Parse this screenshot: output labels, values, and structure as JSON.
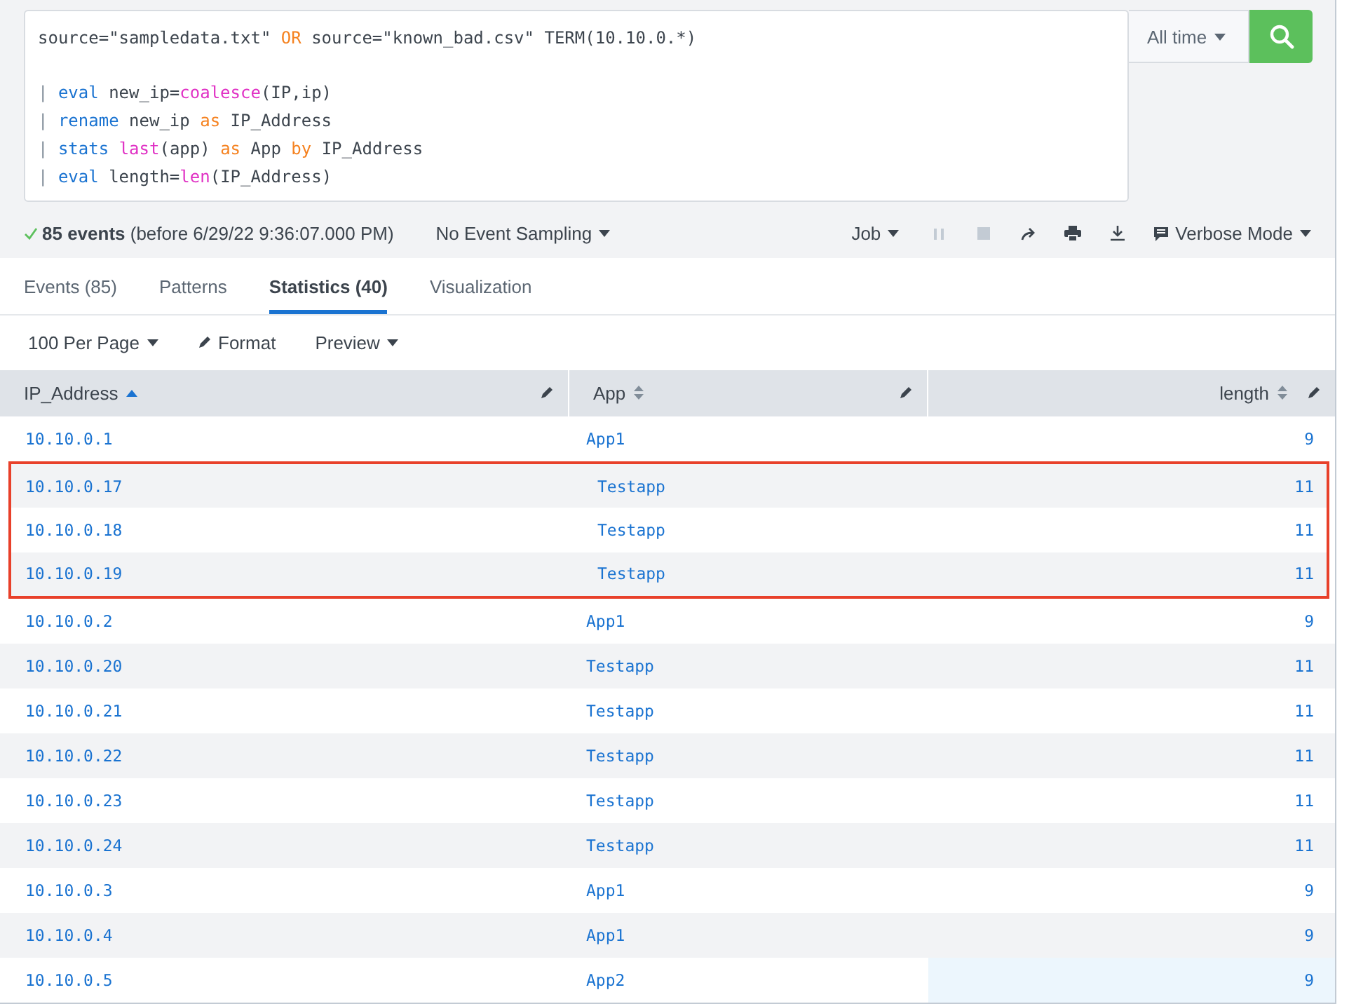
{
  "search": {
    "query_lines": [
      {
        "blank_line_before": false,
        "tokens": [
          {
            "kind": "plain",
            "text": "source=\"sampledata.txt\" "
          },
          {
            "kind": "keyword",
            "text": "OR"
          },
          {
            "kind": "plain",
            "text": " source=\"known_bad.csv\" TERM(10.10.0.*)"
          }
        ]
      },
      {
        "blank_line_before": true,
        "tokens": [
          {
            "kind": "pipe",
            "text": "| "
          },
          {
            "kind": "command",
            "text": "eval"
          },
          {
            "kind": "plain",
            "text": " new_ip="
          },
          {
            "kind": "function",
            "text": "coalesce"
          },
          {
            "kind": "plain",
            "text": "(IP,ip)"
          }
        ]
      },
      {
        "blank_line_before": false,
        "tokens": [
          {
            "kind": "pipe",
            "text": "| "
          },
          {
            "kind": "command",
            "text": "rename"
          },
          {
            "kind": "plain",
            "text": " new_ip "
          },
          {
            "kind": "keyword",
            "text": "as"
          },
          {
            "kind": "plain",
            "text": " IP_Address"
          }
        ]
      },
      {
        "blank_line_before": false,
        "tokens": [
          {
            "kind": "pipe",
            "text": "| "
          },
          {
            "kind": "command",
            "text": "stats "
          },
          {
            "kind": "function",
            "text": "last"
          },
          {
            "kind": "plain",
            "text": "(app) "
          },
          {
            "kind": "keyword",
            "text": "as"
          },
          {
            "kind": "plain",
            "text": " App "
          },
          {
            "kind": "keyword",
            "text": "by"
          },
          {
            "kind": "plain",
            "text": " IP_Address"
          }
        ]
      },
      {
        "blank_line_before": false,
        "tokens": [
          {
            "kind": "pipe",
            "text": "| "
          },
          {
            "kind": "command",
            "text": "eval"
          },
          {
            "kind": "plain",
            "text": " length="
          },
          {
            "kind": "function",
            "text": "len"
          },
          {
            "kind": "plain",
            "text": "(IP_Address)"
          }
        ]
      }
    ],
    "time_range": "All time"
  },
  "status": {
    "event_count": "85 events",
    "detail": "(before 6/29/22 9:36:07.000 PM)",
    "sampling": "No Event Sampling",
    "job": "Job",
    "mode": "Verbose Mode"
  },
  "tabs": [
    {
      "label": "Events (85)",
      "selected": false
    },
    {
      "label": "Patterns",
      "selected": false
    },
    {
      "label": "Statistics (40)",
      "selected": true
    },
    {
      "label": "Visualization",
      "selected": false
    }
  ],
  "toolbar": {
    "per_page": "100 Per Page",
    "format": "Format",
    "preview": "Preview"
  },
  "table": {
    "columns": [
      {
        "label": "IP_Address",
        "sorted_ascending": true,
        "kind": "text"
      },
      {
        "label": "App",
        "sorted_ascending": false,
        "kind": "text"
      },
      {
        "label": "length",
        "sorted_ascending": false,
        "kind": "numeric"
      }
    ],
    "rows": [
      {
        "cells": [
          "10.10.0.1",
          "App1",
          "9"
        ],
        "highlighted": false,
        "hovered": false
      },
      {
        "cells": [
          "10.10.0.17",
          "Testapp",
          "11"
        ],
        "highlighted": true,
        "hovered": false
      },
      {
        "cells": [
          "10.10.0.18",
          "Testapp",
          "11"
        ],
        "highlighted": true,
        "hovered": false
      },
      {
        "cells": [
          "10.10.0.19",
          "Testapp",
          "11"
        ],
        "highlighted": true,
        "hovered": false
      },
      {
        "cells": [
          "10.10.0.2",
          "App1",
          "9"
        ],
        "highlighted": false,
        "hovered": false
      },
      {
        "cells": [
          "10.10.0.20",
          "Testapp",
          "11"
        ],
        "highlighted": false,
        "hovered": false
      },
      {
        "cells": [
          "10.10.0.21",
          "Testapp",
          "11"
        ],
        "highlighted": false,
        "hovered": false
      },
      {
        "cells": [
          "10.10.0.22",
          "Testapp",
          "11"
        ],
        "highlighted": false,
        "hovered": false
      },
      {
        "cells": [
          "10.10.0.23",
          "Testapp",
          "11"
        ],
        "highlighted": false,
        "hovered": false
      },
      {
        "cells": [
          "10.10.0.24",
          "Testapp",
          "11"
        ],
        "highlighted": false,
        "hovered": false
      },
      {
        "cells": [
          "10.10.0.3",
          "App1",
          "9"
        ],
        "highlighted": false,
        "hovered": false
      },
      {
        "cells": [
          "10.10.0.4",
          "App1",
          "9"
        ],
        "highlighted": false,
        "hovered": false
      },
      {
        "cells": [
          "10.10.0.5",
          "App2",
          "9"
        ],
        "highlighted": false,
        "hovered": true
      }
    ]
  }
}
